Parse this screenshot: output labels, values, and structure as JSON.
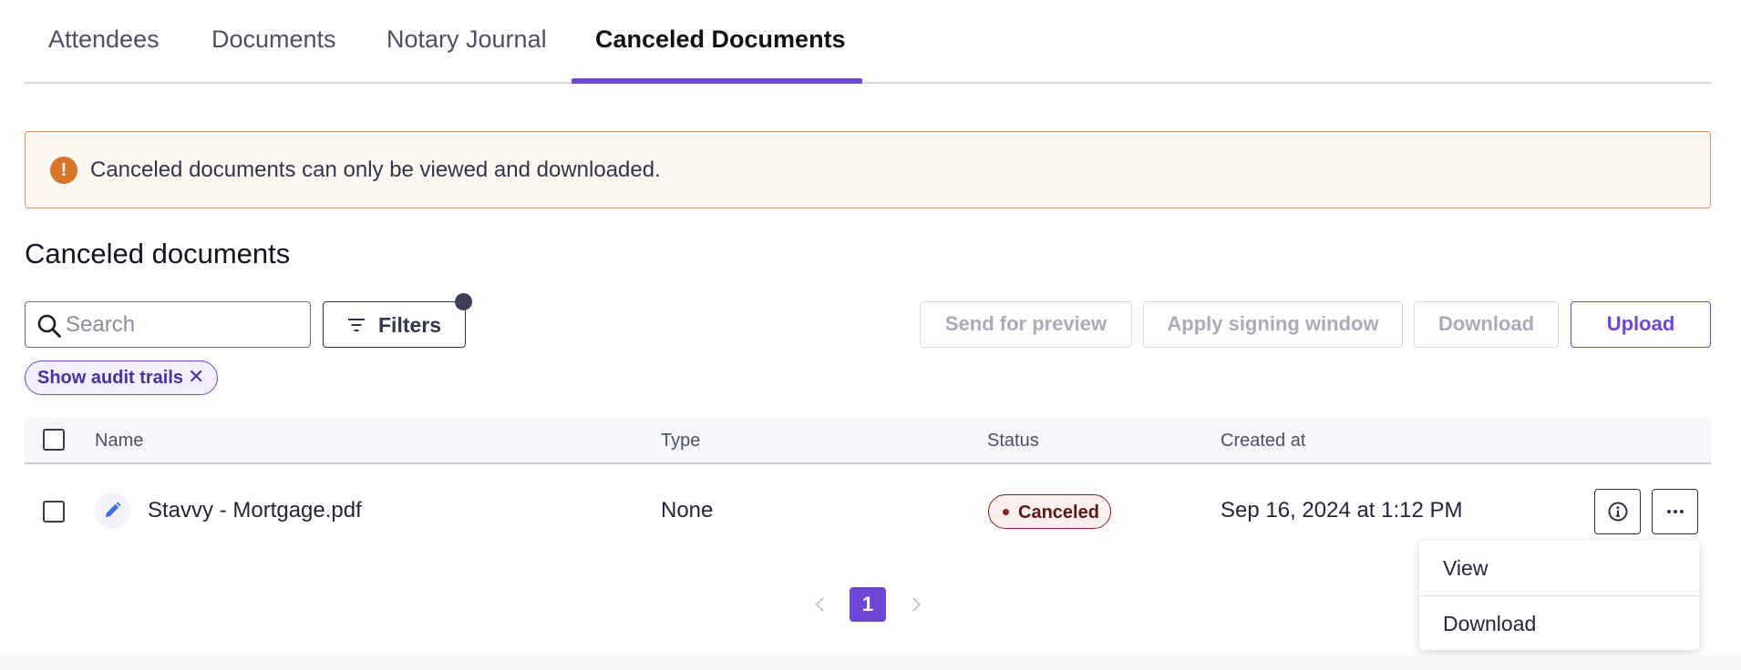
{
  "tabs": [
    {
      "label": "Attendees",
      "active": false
    },
    {
      "label": "Documents",
      "active": false
    },
    {
      "label": "Notary Journal",
      "active": false
    },
    {
      "label": "Canceled Documents",
      "active": true
    }
  ],
  "banner": {
    "icon": "warning-icon",
    "text": "Canceled documents can only be viewed and downloaded."
  },
  "section": {
    "title": "Canceled documents"
  },
  "toolbar": {
    "search_placeholder": "Search",
    "filters_label": "Filters",
    "send_preview_label": "Send for preview",
    "apply_window_label": "Apply signing window",
    "download_label": "Download",
    "upload_label": "Upload"
  },
  "chips": [
    {
      "label": "Show audit trails",
      "close": "✕"
    }
  ],
  "table": {
    "columns": [
      "Name",
      "Type",
      "Status",
      "Created at"
    ],
    "rows": [
      {
        "name": "Stavvy - Mortgage.pdf",
        "type": "None",
        "status": "Canceled",
        "created_at": "Sep 16, 2024 at 1:12 PM"
      }
    ]
  },
  "row_menu": {
    "items": [
      "View",
      "Download"
    ]
  },
  "pagination": {
    "current_page": "1"
  },
  "colors": {
    "accent": "#6e47d6",
    "warning": "#d8762c",
    "status_canceled": "#8a1e1e"
  }
}
